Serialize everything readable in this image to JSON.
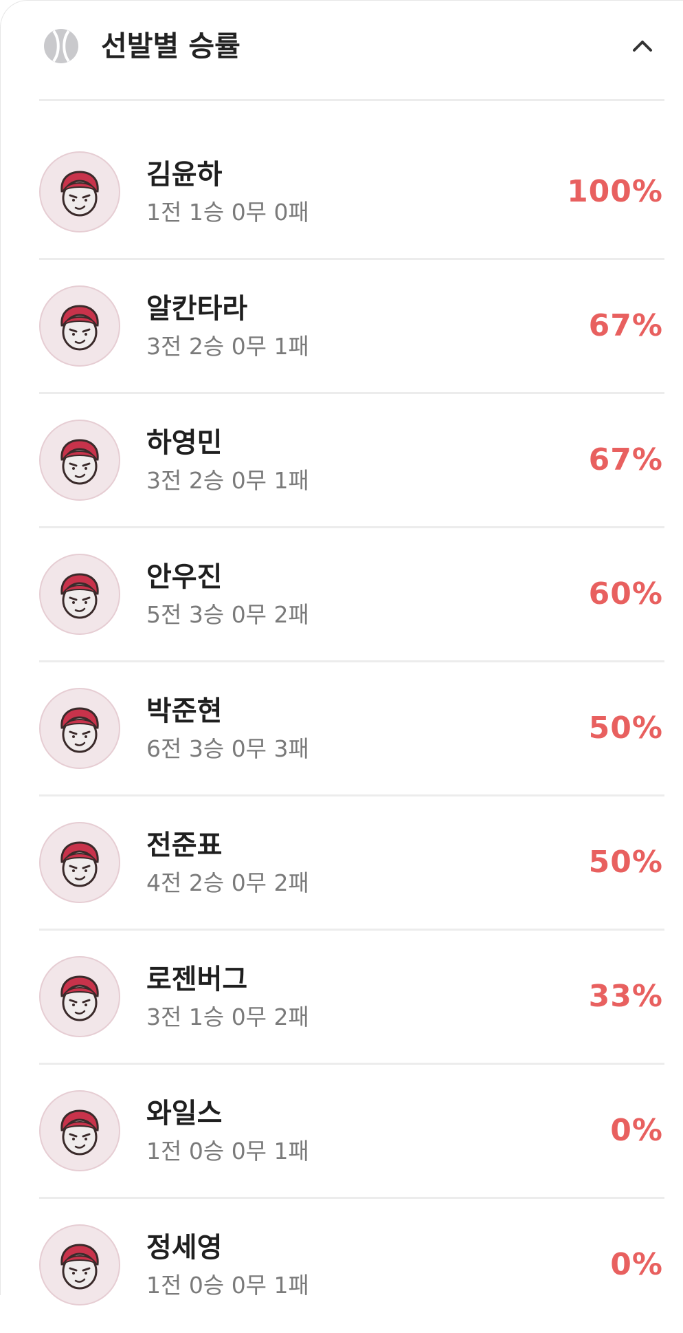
{
  "header": {
    "title": "선발별 승률",
    "icon": "baseball-icon",
    "toggle_icon": "chevron-up-icon"
  },
  "colors": {
    "accent": "#e8605f",
    "avatar_bg": "#f2e6e9",
    "divider": "#ececec"
  },
  "pitchers": [
    {
      "name": "김윤하",
      "record": "1전 1승 0무 0패",
      "rate": "100%"
    },
    {
      "name": "알칸타라",
      "record": "3전 2승 0무 1패",
      "rate": "67%"
    },
    {
      "name": "하영민",
      "record": "3전 2승 0무 1패",
      "rate": "67%"
    },
    {
      "name": "안우진",
      "record": "5전 3승 0무 2패",
      "rate": "60%"
    },
    {
      "name": "박준현",
      "record": "6전 3승 0무 3패",
      "rate": "50%"
    },
    {
      "name": "전준표",
      "record": "4전 2승 0무 2패",
      "rate": "50%"
    },
    {
      "name": "로젠버그",
      "record": "3전 1승 0무 2패",
      "rate": "33%"
    },
    {
      "name": "와일스",
      "record": "1전 0승 0무 1패",
      "rate": "0%"
    },
    {
      "name": "정세영",
      "record": "1전 0승 0무 1패",
      "rate": "0%"
    }
  ]
}
